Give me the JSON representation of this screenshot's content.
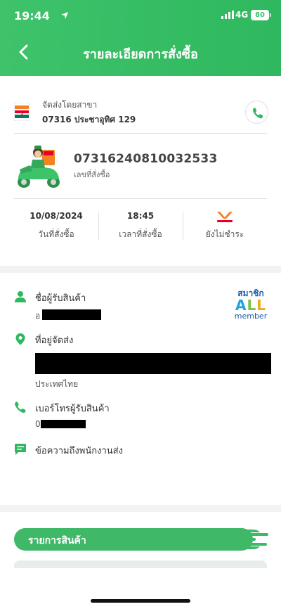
{
  "status": {
    "time": "19:44",
    "network": "4G",
    "battery": "80"
  },
  "nav": {
    "title": "รายละเอียดการสั่งซื้อ"
  },
  "store": {
    "subtitle": "จัดส่งโดยสาขา",
    "name": "07316 ประชาอุทิศ 129"
  },
  "order": {
    "number": "07316240810032533",
    "number_label": "เลขที่สั่งซื้อ"
  },
  "info": {
    "date": "10/08/2024",
    "date_label": "วันที่สั่งซื้อ",
    "time": "18:45",
    "time_label": "เวลาที่สั่งซื้อ",
    "payment_label": "ยังไม่ชำระ"
  },
  "recipient": {
    "name_label": "ชื่อผู้รับสินค้า",
    "name_prefix": "อ",
    "address_label": "ที่อยู่จัดส่ง",
    "country": "ประเทศไทย",
    "phone_label": "เบอร์โทรผู้รับสินค้า",
    "phone_prefix": "0",
    "message_label": "ข้อความถึงพนักงานส่ง"
  },
  "member_badge": {
    "top": "สมาชิก",
    "middle": "ALL",
    "bottom": "member"
  },
  "items_section": {
    "title": "รายการสินค้า"
  },
  "colors": {
    "brand_green": "#3ec36a",
    "icon_green": "#2fb85f"
  }
}
